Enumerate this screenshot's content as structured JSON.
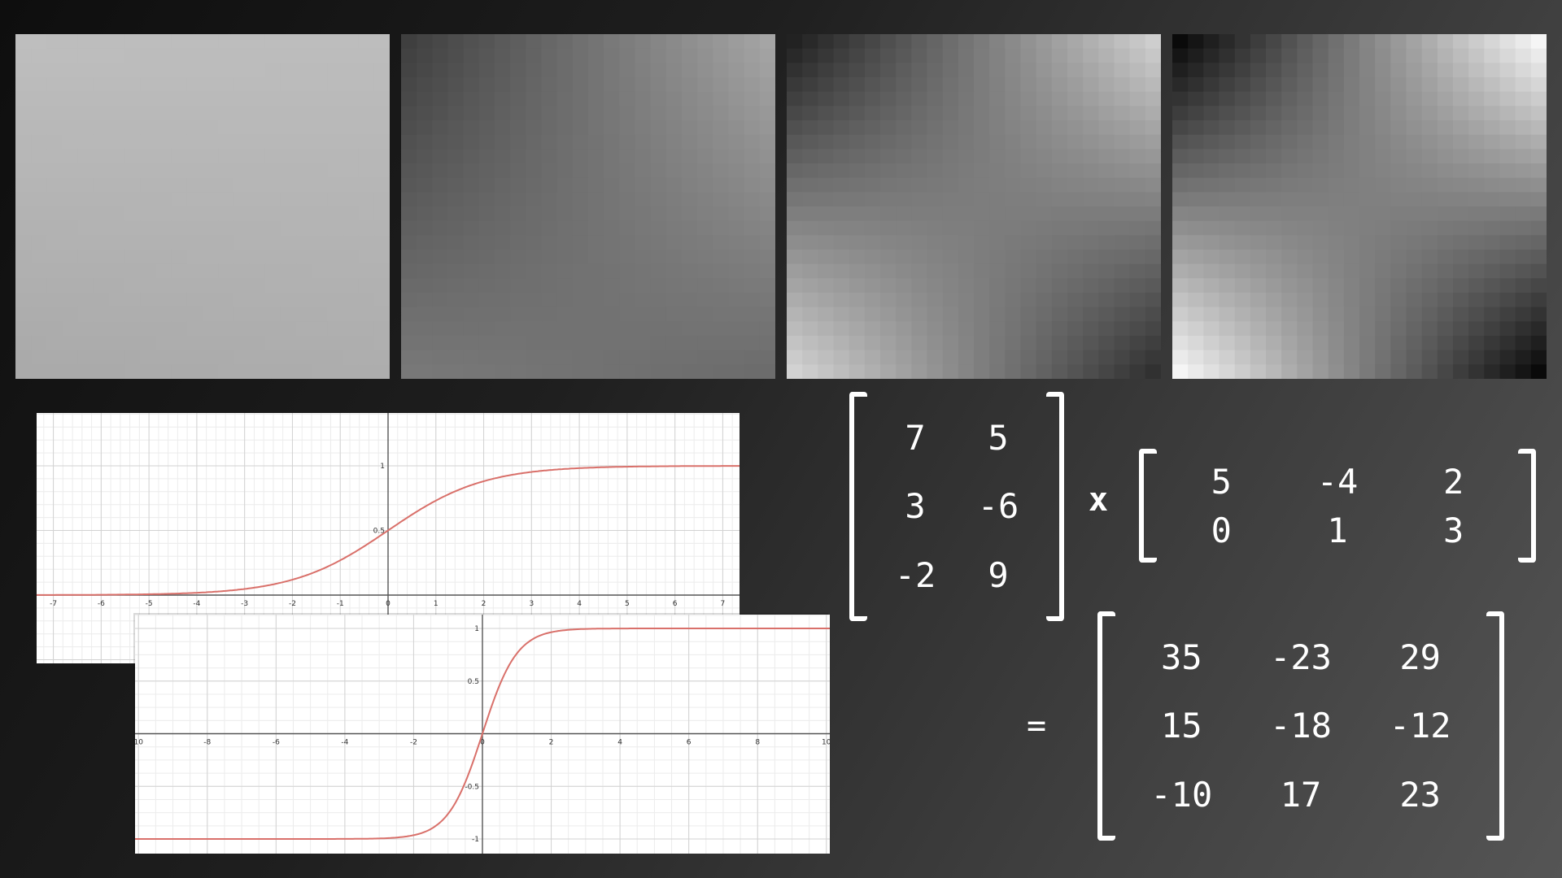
{
  "panels": [
    {
      "name": "gradient-panel-1",
      "colors": {
        "tl": "#bebebe",
        "tr": "#bdbdbd",
        "bl": "#a9a9a9",
        "br": "#adadad"
      }
    },
    {
      "name": "gradient-panel-2",
      "colors": {
        "tl": "#3c3c3c",
        "tr": "#a8a8a8",
        "bl": "#7a7a7a",
        "br": "#6a6a6a"
      }
    },
    {
      "name": "gradient-panel-3",
      "colors": {
        "tl": "#1a1a1a",
        "tr": "#d5d5d5",
        "bl": "#dadada",
        "br": "#2a2a2a"
      }
    },
    {
      "name": "gradient-panel-4",
      "colors": {
        "tl": "#000000",
        "tr": "#ffffff",
        "bl": "#ffffff",
        "br": "#000000"
      }
    }
  ],
  "graph1": {
    "xticks": [
      "-7",
      "-6",
      "-5",
      "-4",
      "-3",
      "-2",
      "-1",
      "0",
      "1",
      "2",
      "3",
      "4",
      "5",
      "6",
      "7"
    ],
    "yticks": [
      "0.5",
      "1"
    ],
    "curve_color": "#d9706a"
  },
  "graph2": {
    "xticks": [
      "10",
      "-8",
      "-6",
      "-4",
      "-2",
      "0",
      "2",
      "4",
      "6",
      "8",
      "10"
    ],
    "yticks": [
      "1",
      "0.5",
      "-0.5",
      "-1"
    ],
    "curve_color": "#d9706a"
  },
  "matrices": {
    "a": [
      [
        "7",
        "5"
      ],
      [
        "3",
        "-6"
      ],
      [
        "-2",
        "9"
      ]
    ],
    "b": [
      [
        "5",
        "-4",
        "2"
      ],
      [
        "0",
        "1",
        "3"
      ]
    ],
    "result": [
      [
        "35",
        "-23",
        "29"
      ],
      [
        "15",
        "-18",
        "-12"
      ],
      [
        "-10",
        "17",
        "23"
      ]
    ]
  },
  "operators": {
    "times": "x",
    "equals": "="
  }
}
